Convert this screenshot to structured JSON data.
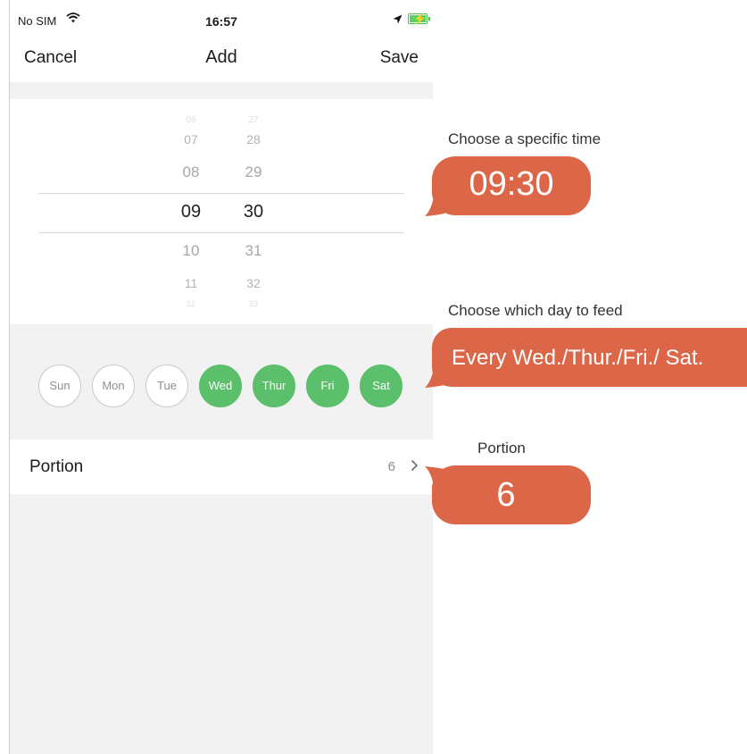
{
  "status_bar": {
    "carrier": "No SIM",
    "time": "16:57"
  },
  "nav": {
    "cancel": "Cancel",
    "title": "Add",
    "save": "Save"
  },
  "time_picker": {
    "hours": [
      "06",
      "07",
      "08",
      "09",
      "10",
      "11",
      "12"
    ],
    "minutes": [
      "27",
      "28",
      "29",
      "30",
      "31",
      "32",
      "33"
    ],
    "selected_hour": "09",
    "selected_minute": "30"
  },
  "days": [
    {
      "label": "Sun",
      "selected": false
    },
    {
      "label": "Mon",
      "selected": false
    },
    {
      "label": "Tue",
      "selected": false
    },
    {
      "label": "Wed",
      "selected": true
    },
    {
      "label": "Thur",
      "selected": true
    },
    {
      "label": "Fri",
      "selected": true
    },
    {
      "label": "Sat",
      "selected": true
    }
  ],
  "portion": {
    "label": "Portion",
    "value": "6"
  },
  "annotations": {
    "time_caption": "Choose a specific time",
    "time_value": "09:30",
    "day_caption": "Choose which day to feed",
    "day_value": "Every  Wed./Thur./Fri./ Sat.",
    "portion_caption": "Portion",
    "portion_value": "6"
  },
  "colors": {
    "accent_green": "#5cbf6b",
    "callout": "#dc6748"
  },
  "icons": [
    "wifi-icon",
    "location-arrow-icon",
    "battery-charging-icon",
    "chevron-right-icon"
  ]
}
